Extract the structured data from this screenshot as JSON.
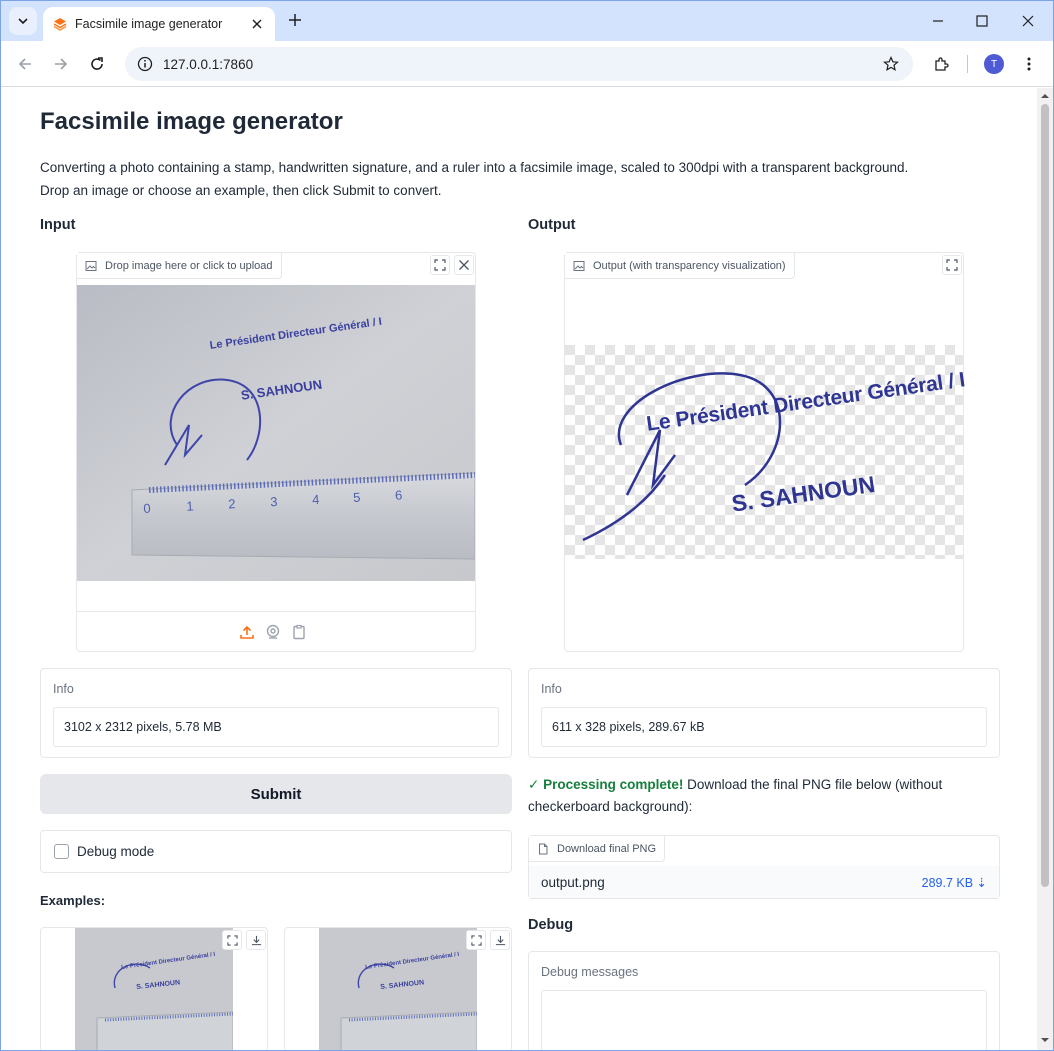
{
  "browser": {
    "tab_title": "Facsimile image generator",
    "url": "127.0.0.1:7860",
    "profile_initial": "T"
  },
  "page": {
    "title": "Facsimile image generator",
    "description_line1": "Converting a photo containing a stamp, handwritten signature, and a ruler into a facsimile image, scaled to 300dpi with a transparent background.",
    "description_line2": "Drop an image or choose an example, then click Submit to convert."
  },
  "input": {
    "section_label": "Input",
    "upload_badge": "Drop image here or click to upload",
    "stamp_line1": "Le Président Directeur Général / I",
    "stamp_line2": "S. SAHNOUN",
    "ruler_numbers": [
      "0",
      "1",
      "2",
      "3",
      "4",
      "5",
      "6"
    ],
    "info_label": "Info",
    "info_value": "3102 x 2312 pixels, 5.78 MB",
    "submit_label": "Submit",
    "debug_label": "Debug mode",
    "examples_label": "Examples:",
    "example_stamp_line1": "Le Président Directeur Général / I",
    "example_stamp_line2": "S. SAHNOUN"
  },
  "output": {
    "section_label": "Output",
    "image_badge": "Output (with transparency visualization)",
    "stamp_line1": "Le Président Directeur Général / I",
    "stamp_line2": "S. SAHNOUN",
    "info_label": "Info",
    "info_value": "611 x 328 pixels, 289.67 kB",
    "complete_check": "✓",
    "complete_strong": "Processing complete!",
    "complete_text": " Download the final PNG file below (without checkerboard background):",
    "download_badge": "Download final PNG",
    "file_name": "output.png",
    "file_size": "289.7 KB ⇣",
    "debug_section_label": "Debug",
    "debug_messages_label": "Debug messages"
  },
  "colors": {
    "ink": "#3a3f9e",
    "upload_accent": "#f97316",
    "success": "#15803d",
    "link": "#2563eb"
  }
}
